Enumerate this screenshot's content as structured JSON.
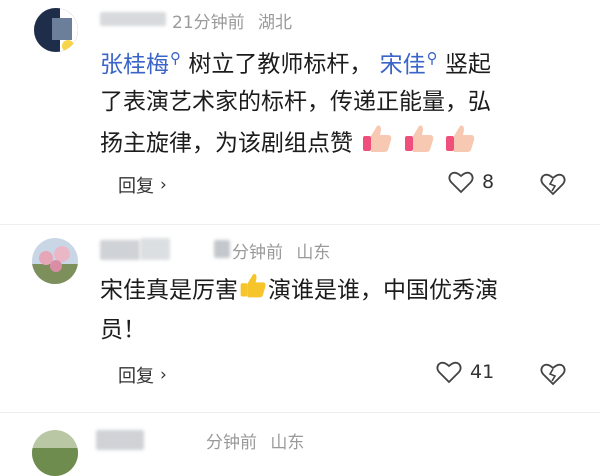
{
  "comments": [
    {
      "time": "21分钟前",
      "location": "湖北",
      "mention1": "张桂梅",
      "seg1": "树立了教师标杆，",
      "mention2": "宋佳",
      "seg2": "竖起",
      "line2": "了表演艺术家的标杆，传递正能量，弘",
      "line3": "扬主旋律，为该剧组点赞",
      "reply_label": "回复",
      "likes": "8"
    },
    {
      "time": "分钟前",
      "location": "山东",
      "seg1": "宋佳真是厉害",
      "seg2": "演谁是谁，中国优秀演",
      "line2": "员！",
      "reply_label": "回复",
      "likes": "41"
    },
    {
      "time": "分钟前",
      "location": "山东"
    }
  ],
  "icons": {
    "like": "heart-outline-icon",
    "dislike": "broken-heart-icon",
    "reply_arrow": "chevron-right-icon",
    "mention_marker": "search-icon",
    "thumbs_up": "thumbs-up-emoji"
  },
  "colors": {
    "mention": "#3a64c8",
    "meta": "#9a9a9a",
    "thumb_yellow": "#f6c42b",
    "thumb_pink": "#f3a6b3"
  }
}
